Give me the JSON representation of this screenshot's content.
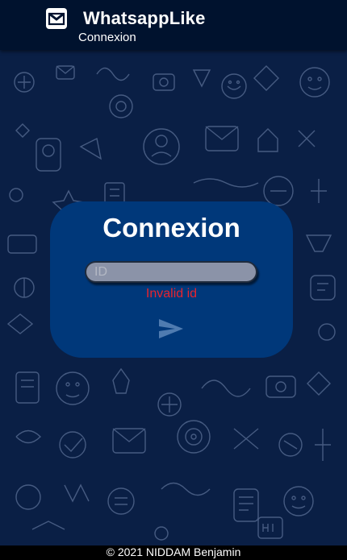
{
  "header": {
    "app_title": "WhatsappLike",
    "subtitle": "Connexion",
    "icon": "envelope-icon"
  },
  "login_card": {
    "title": "Connexion",
    "id_input": {
      "value": "",
      "placeholder": "ID"
    },
    "error": "Invalid id",
    "send_icon": "send-icon"
  },
  "footer": {
    "text": "© 2021 NIDDAM Benjamin"
  },
  "colors": {
    "header_bg": "#00122e",
    "background": "#0a1f45",
    "doodle": "#5a6f96",
    "card_bg": "#00387a",
    "input_bg": "#8b93a8",
    "error": "#e8242f",
    "footer_bg": "#000000"
  }
}
